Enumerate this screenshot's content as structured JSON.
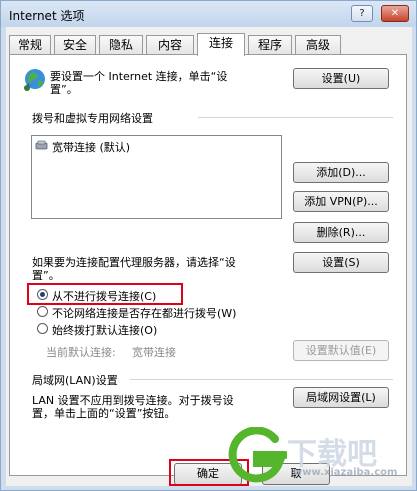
{
  "window": {
    "title": "Internet 选项",
    "help_label": "?",
    "close_label": "✕"
  },
  "tabs": [
    "常规",
    "安全",
    "隐私",
    "内容",
    "连接",
    "程序",
    "高级"
  ],
  "active_tab": "连接",
  "setup": {
    "text_line1": "要设置一个 Internet 连接，单击“设",
    "text_line2": "置”。",
    "button": "设置(U)",
    "icon": "globe-icon"
  },
  "dialup": {
    "header": "拨号和虚拟专用网络设置",
    "items": [
      {
        "label": "宽带连接 (默认)",
        "icon": "connection-icon"
      }
    ],
    "add_button": "添加(D)...",
    "add_vpn_button": "添加 VPN(P)...",
    "remove_button": "删除(R)...",
    "proxy_text_line1": "如果要为连接配置代理服务器，请选择“设",
    "proxy_text_line2": "置”。",
    "settings_button": "设置(S)",
    "options": [
      {
        "label": "从不进行拨号连接(C)",
        "selected": true
      },
      {
        "label": "不论网络连接是否存在都进行拨号(W)",
        "selected": false
      },
      {
        "label": "始终拨打默认连接(O)",
        "selected": false
      }
    ],
    "current_default_label": "当前默认连接:",
    "current_default_value": "宽带连接",
    "set_default_button": "设置默认值(E)"
  },
  "lan": {
    "header": "局域网(LAN)设置",
    "text_line1": "LAN 设置不应用到拨号连接。对于拨号设",
    "text_line2": "置，单击上面的“设置”按钮。",
    "button": "局域网设置(L)"
  },
  "footer": {
    "ok_button": "确定",
    "cancel_button": "取"
  },
  "watermark": {
    "text": "下载吧",
    "sub": "www.xiazaiba.com"
  },
  "colors": {
    "highlight": "#e0001a",
    "watermark_green": "#55b52c"
  }
}
